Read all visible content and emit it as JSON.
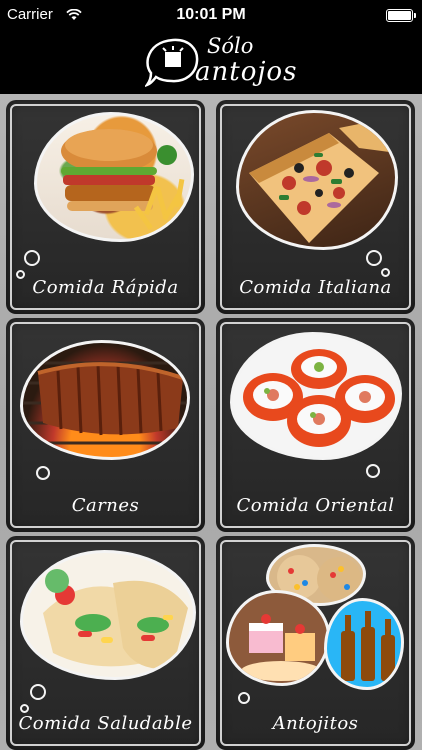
{
  "status_bar": {
    "carrier": "Carrier",
    "time": "10:01 PM"
  },
  "header": {
    "logo_top": "Sólo",
    "logo_bottom": "antojos"
  },
  "categories": [
    {
      "label": "Comida Rápida",
      "icon": "burger-image"
    },
    {
      "label": "Comida Italiana",
      "icon": "pizza-image"
    },
    {
      "label": "Carnes",
      "icon": "ribs-image"
    },
    {
      "label": "Comida Oriental",
      "icon": "sushi-image"
    },
    {
      "label": "Comida Saludable",
      "icon": "wrap-image"
    },
    {
      "label": "Antojitos",
      "icon": "desserts-image"
    }
  ],
  "colors": {
    "chalkboard": "#2c2c2c",
    "frame": "#f0f0f0",
    "background": "#b0b0b0"
  }
}
